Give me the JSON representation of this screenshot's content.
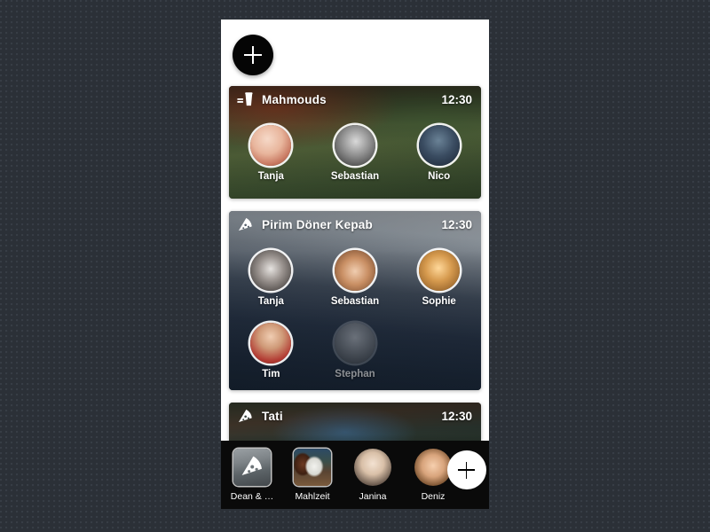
{
  "app": {
    "background_color": "#2b3037",
    "surface_color": "#ffffff",
    "bottom_bar_color": "#0a0a0a"
  },
  "top_action": {
    "name": "add-event",
    "label": "+",
    "icon": "plus-icon"
  },
  "feed": {
    "cards": [
      {
        "title": "Mahmouds",
        "time": "12:30",
        "icon": "burger-drink-icon",
        "photo_theme": "restaurant-interior-green",
        "attendees": [
          {
            "name": "Tanja",
            "state": "accepted",
            "avatar_theme": "avatar-tanja-1"
          },
          {
            "name": "Sebastian",
            "state": "accepted",
            "avatar_theme": "avatar-sebastian-1"
          },
          {
            "name": "Nico",
            "state": "accepted",
            "avatar_theme": "avatar-nico"
          }
        ]
      },
      {
        "title": "Pirim Döner Kepab",
        "time": "12:30",
        "icon": "pizza-slice-icon",
        "photo_theme": "street-cafe-dusk",
        "attendees": [
          {
            "name": "Tanja",
            "state": "accepted",
            "avatar_theme": "avatar-tanja-2"
          },
          {
            "name": "Sebastian",
            "state": "accepted",
            "avatar_theme": "avatar-sebastian-2"
          },
          {
            "name": "Sophie",
            "state": "accepted",
            "avatar_theme": "avatar-sophie"
          },
          {
            "name": "Tim",
            "state": "accepted",
            "avatar_theme": "avatar-tim"
          },
          {
            "name": "Stephan",
            "state": "pending",
            "avatar_theme": "avatar-stephan"
          }
        ]
      },
      {
        "title": "Tati",
        "time": "12:30",
        "icon": "pizza-slice-icon",
        "photo_theme": "graffiti-wall-night",
        "attendees": []
      }
    ]
  },
  "bottom_bar": {
    "items": [
      {
        "label": "Dean & …",
        "kind": "place",
        "icon": "pizza-slice-icon",
        "thumb_theme": "thumb-dean"
      },
      {
        "label": "Mahlzeit",
        "kind": "place",
        "icon": "none",
        "thumb_theme": "thumb-mahlzeit"
      },
      {
        "label": "Janina",
        "kind": "person",
        "icon": "none",
        "thumb_theme": "avatar-janina"
      },
      {
        "label": "Deniz",
        "kind": "person",
        "icon": "none",
        "thumb_theme": "avatar-deniz"
      }
    ],
    "add_action": {
      "name": "add-contact",
      "label": "+",
      "icon": "plus-icon"
    }
  }
}
